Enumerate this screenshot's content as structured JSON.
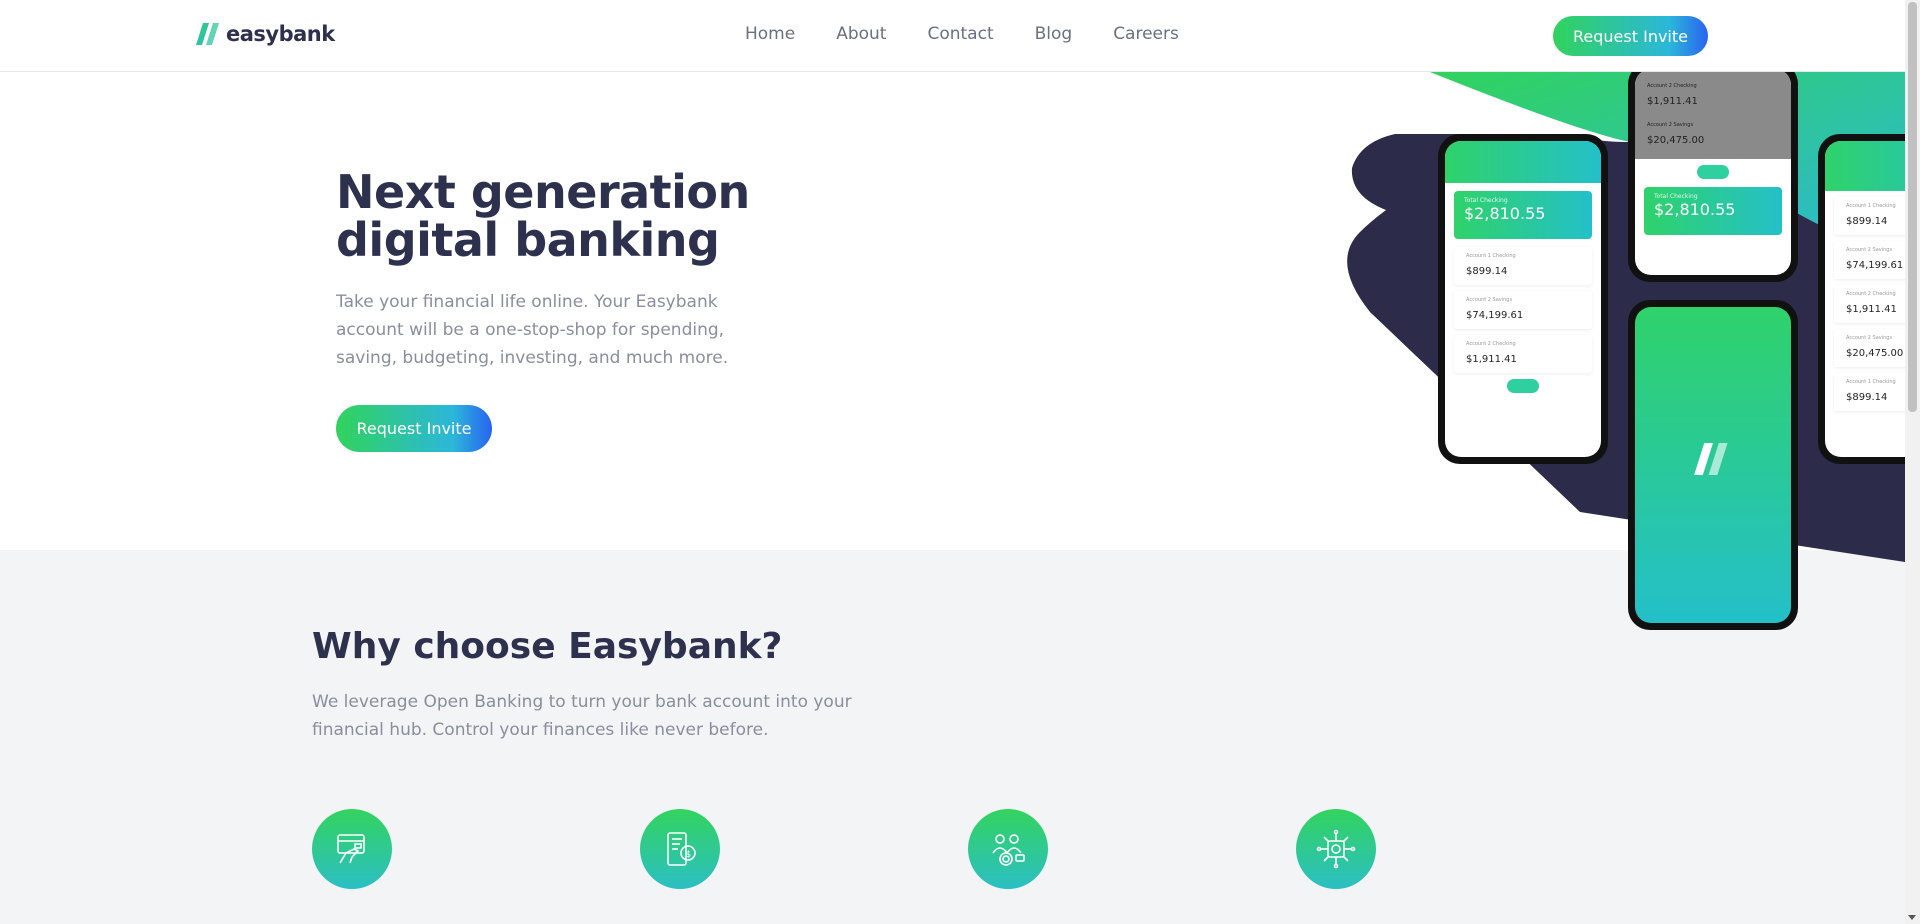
{
  "header": {
    "logo_text": "easybank",
    "nav": [
      "Home",
      "About",
      "Contact",
      "Blog",
      "Careers"
    ],
    "cta_label": "Request Invite"
  },
  "hero": {
    "title_line1": "Next generation",
    "title_line2": "digital banking",
    "text": "Take your financial life online. Your Easybank account will be a one-stop-shop for spending, saving, budgeting, investing, and much more.",
    "cta_label": "Request Invite"
  },
  "why": {
    "title": "Why choose Easybank?",
    "text": "We leverage Open Banking to turn your bank account into your financial hub. Control your finances like never before.",
    "features": [
      {
        "icon": "online-banking-icon"
      },
      {
        "icon": "simple-budgeting-icon"
      },
      {
        "icon": "fast-onboarding-icon"
      },
      {
        "icon": "open-api-icon"
      }
    ]
  },
  "phones": {
    "total_label": "Total Checking",
    "total": "$2,810.55",
    "accounts": [
      {
        "label": "Account 1 Checking",
        "amount": "$899.14"
      },
      {
        "label": "Account 2 Savings",
        "amount": "$74,199.61"
      },
      {
        "label": "Account 2 Checking",
        "amount": "$1,911.41"
      },
      {
        "label": "Account 2 Savings",
        "amount": "$20,475.00"
      }
    ]
  },
  "colors": {
    "dark_blue": "#2d314d",
    "lime_green": "#31d35c",
    "bright_cyan": "#2bb7da",
    "grayish_blue": "#9698a6",
    "light_bg": "#f3f4f6"
  }
}
